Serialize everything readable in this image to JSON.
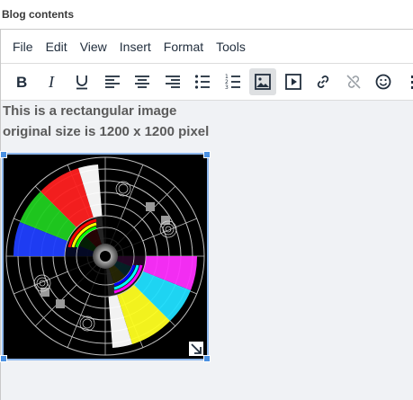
{
  "field_label": "Blog contents",
  "menu": [
    "File",
    "Edit",
    "View",
    "Insert",
    "Format",
    "Tools"
  ],
  "toolbar": [
    {
      "icon": "bold-icon",
      "active": false
    },
    {
      "icon": "italic-icon",
      "active": false
    },
    {
      "icon": "underline-icon",
      "active": false
    },
    {
      "icon": "align-left-icon",
      "active": false
    },
    {
      "icon": "align-center-icon",
      "active": false
    },
    {
      "icon": "align-right-icon",
      "active": false
    },
    {
      "icon": "bullet-list-icon",
      "active": false
    },
    {
      "icon": "numbered-list-icon",
      "active": false
    },
    {
      "icon": "image-icon",
      "active": true
    },
    {
      "icon": "media-icon",
      "active": false
    },
    {
      "icon": "link-icon",
      "active": false
    },
    {
      "icon": "unlink-icon",
      "active": false
    },
    {
      "icon": "emoticon-icon",
      "active": false
    },
    {
      "icon": "more-icon",
      "active": false
    }
  ],
  "content": {
    "line1": "This is a rectangular image",
    "line2": "original size is 1200 x 1200 pixel"
  },
  "colors": {
    "toolbar_active_bg": "#dee0e2",
    "selection_handle": "#4a90e2",
    "text": "#5b5b5b",
    "canvas_bg": "#f0f2f5"
  }
}
